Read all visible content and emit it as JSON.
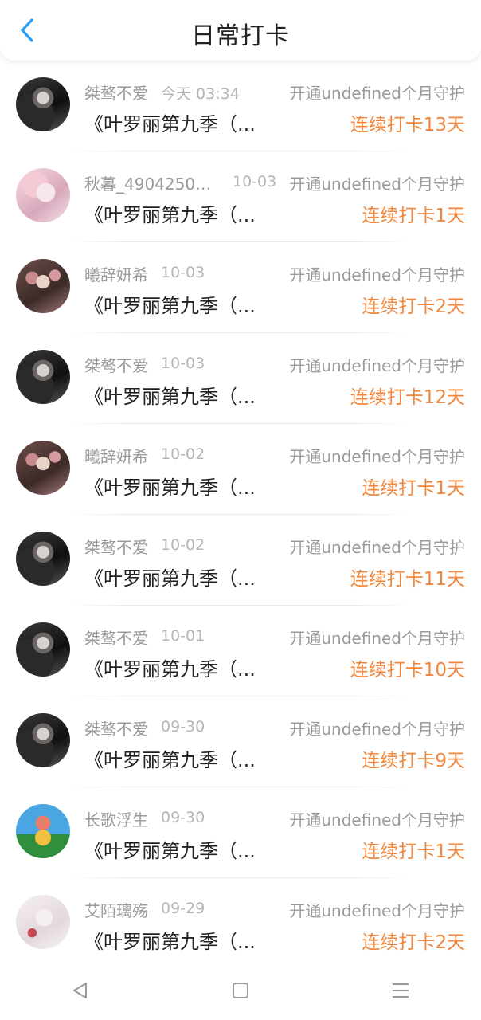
{
  "header": {
    "title": "日常打卡",
    "back_icon": "chevron-left-icon",
    "accent": "#2a9df4"
  },
  "colors": {
    "streak": "#f0873c",
    "name": "#9a9a9a",
    "date": "#b5b5b5"
  },
  "items": [
    {
      "name": "桀骜不爱",
      "date": "今天 03:34",
      "sub": "开通undefined个月守护",
      "text": "《叶罗丽第九季（...",
      "streak": "连续打卡13天",
      "avatar": "dark"
    },
    {
      "name": "秋暮_49042500...",
      "date": "10-03",
      "sub": "开通undefined个月守护",
      "text": "《叶罗丽第九季（...",
      "streak": "连续打卡1天",
      "avatar": "pink"
    },
    {
      "name": "曦辞妍希",
      "date": "10-03",
      "sub": "开通undefined个月守护",
      "text": "《叶罗丽第九季（...",
      "streak": "连续打卡2天",
      "avatar": "flower"
    },
    {
      "name": "桀骜不爱",
      "date": "10-03",
      "sub": "开通undefined个月守护",
      "text": "《叶罗丽第九季（...",
      "streak": "连续打卡12天",
      "avatar": "dark"
    },
    {
      "name": "曦辞妍希",
      "date": "10-02",
      "sub": "开通undefined个月守护",
      "text": "《叶罗丽第九季（...",
      "streak": "连续打卡1天",
      "avatar": "flower"
    },
    {
      "name": "桀骜不爱",
      "date": "10-02",
      "sub": "开通undefined个月守护",
      "text": "《叶罗丽第九季（...",
      "streak": "连续打卡11天",
      "avatar": "dark"
    },
    {
      "name": "桀骜不爱",
      "date": "10-01",
      "sub": "开通undefined个月守护",
      "text": "《叶罗丽第九季（...",
      "streak": "连续打卡10天",
      "avatar": "dark"
    },
    {
      "name": "桀骜不爱",
      "date": "09-30",
      "sub": "开通undefined个月守护",
      "text": "《叶罗丽第九季（...",
      "streak": "连续打卡9天",
      "avatar": "dark"
    },
    {
      "name": "长歌浮生",
      "date": "09-30",
      "sub": "开通undefined个月守护",
      "text": "《叶罗丽第九季（...",
      "streak": "连续打卡1天",
      "avatar": "cartoon"
    },
    {
      "name": "艾陌璃殇",
      "date": "09-29",
      "sub": "开通undefined个月守护",
      "text": "《叶罗丽第九季（...",
      "streak": "连续打卡2天",
      "avatar": "white"
    }
  ],
  "navbar": {
    "back": "triangle-back-icon",
    "home": "square-home-icon",
    "menu": "menu-lines-icon"
  }
}
